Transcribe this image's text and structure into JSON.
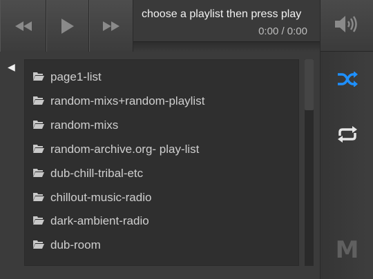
{
  "transport": {
    "prev_icon": "skip-back-icon",
    "play_icon": "play-icon",
    "next_icon": "skip-forward-icon"
  },
  "now_playing": {
    "title": "choose a playlist then press play",
    "time": "0:00 / 0:00",
    "progress": 0
  },
  "side": {
    "volume_icon": "volume-icon",
    "shuffle_icon": "shuffle-icon",
    "shuffle_color": "#1e90ff",
    "repeat_icon": "repeat-icon",
    "m_label": "M"
  },
  "back_icon": "back-arrow-icon",
  "playlists": [
    {
      "label": "page1-list"
    },
    {
      "label": "random-mixs+random-playlist"
    },
    {
      "label": "random-mixs"
    },
    {
      "label": "random-archive.org- play-list"
    },
    {
      "label": "dub-chill-tribal-etc"
    },
    {
      "label": "chillout-music-radio"
    },
    {
      "label": "dark-ambient-radio"
    },
    {
      "label": "dub-room"
    }
  ]
}
